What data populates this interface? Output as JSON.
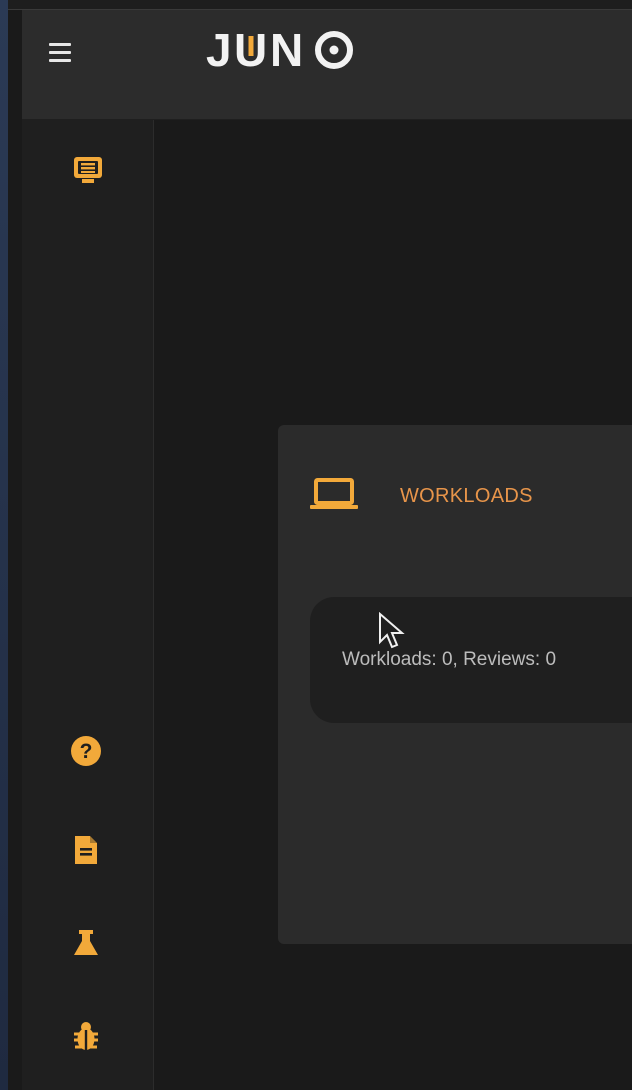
{
  "app": {
    "logo": "JUNO"
  },
  "top_bar": {
    "menu_icon": "hamburger-menu-icon"
  },
  "sidebar": {
    "items": [
      {
        "icon": "monitor-list-icon"
      },
      {
        "icon": "help-question-icon"
      },
      {
        "icon": "document-icon"
      },
      {
        "icon": "flask-icon"
      },
      {
        "icon": "bug-icon"
      }
    ]
  },
  "workloads_card": {
    "icon": "laptop-icon",
    "title": "WORKLOADS",
    "summary": "Workloads: 0, Reviews: 0"
  },
  "colors": {
    "accent": "#e8954a",
    "app_bar": "#2c2c2c",
    "sidebar": "#1f1f1f",
    "background": "#1a1a1a",
    "card": "#2b2b2b"
  }
}
